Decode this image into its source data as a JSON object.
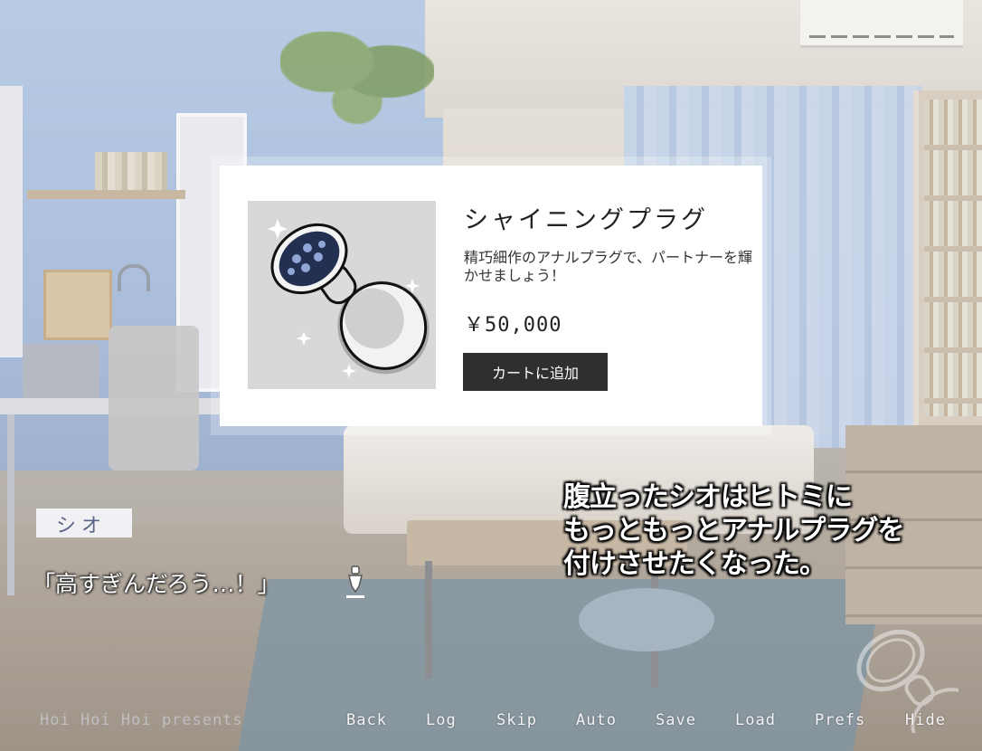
{
  "product": {
    "name": "シャイニングプラグ",
    "description": "精巧細作のアナルプラグで、パートナーを輝かせましょう！",
    "price": "￥50,000",
    "add_to_cart_label": "カートに追加"
  },
  "dialogue": {
    "speaker": "シオ",
    "line": "「高すぎんだろう…！」"
  },
  "narration": {
    "lines": [
      "腹立ったシオはヒトミに",
      "もっともっとアナルプラグを",
      "付けさせたくなった。"
    ]
  },
  "footer": {
    "credit": "Hoi Hoi Hoi presents"
  },
  "quick_menu": {
    "back": "Back",
    "log": "Log",
    "skip": "Skip",
    "auto": "Auto",
    "save": "Save",
    "load": "Load",
    "prefs": "Prefs",
    "hide": "Hide"
  },
  "icons": {
    "product": "butt-plug-icon",
    "continue": "click-to-continue-icon",
    "watermark": "butt-plug-icon"
  },
  "colors": {
    "button_bg": "#2f2f2f",
    "name_box_bg": "#f1f1f5",
    "speaker_text": "#5a6486"
  }
}
